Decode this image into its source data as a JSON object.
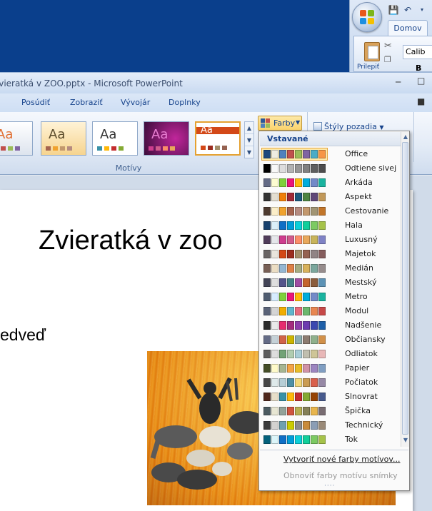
{
  "mini_window": {
    "home_tab": "Domov",
    "paste_label": "Prilepiť",
    "font_value": "Calib",
    "bold_label": "B"
  },
  "window": {
    "title": "Zvieratká v ZOO.pptx - Microsoft PowerPoint"
  },
  "tabs": [
    {
      "label": "Posúdiť"
    },
    {
      "label": "Zobraziť"
    },
    {
      "label": "Vývojár"
    },
    {
      "label": "Doplnky"
    }
  ],
  "ribbon": {
    "themes_group_label": "Motívy",
    "theme_aa": "Aa",
    "colors_button": "Farby",
    "background_styles_button": "Štýly pozadia"
  },
  "slide": {
    "title": "Zvieratká v zoo",
    "bullet": "edveď"
  },
  "colors_dropdown": {
    "section_header": "Vstavané",
    "selected": "Office",
    "schemes": [
      {
        "name": "Office",
        "colors": [
          "#1f497d",
          "#eeece1",
          "#4f81bd",
          "#c0504d",
          "#9bbb59",
          "#8064a2",
          "#4bacc6",
          "#f79646"
        ]
      },
      {
        "name": "Odtiene sivej",
        "colors": [
          "#000000",
          "#f8f8f8",
          "#dddddd",
          "#b2b2b2",
          "#969696",
          "#808080",
          "#5f5f5f",
          "#4d4d4d"
        ]
      },
      {
        "name": "Arkáda",
        "colors": [
          "#646b86",
          "#fdfcd0",
          "#7fd13b",
          "#ea157a",
          "#feb80a",
          "#00addc",
          "#738ac8",
          "#1ab39f"
        ]
      },
      {
        "name": "Aspekt",
        "colors": [
          "#323232",
          "#e3ded1",
          "#f07f09",
          "#9f2936",
          "#1b587c",
          "#4e8542",
          "#604878",
          "#c19859"
        ]
      },
      {
        "name": "Cestovanie",
        "colors": [
          "#4e3b30",
          "#fbeec9",
          "#f0a22e",
          "#a5644e",
          "#b58b80",
          "#c3986d",
          "#a19574",
          "#c17529"
        ]
      },
      {
        "name": "Hala",
        "colors": [
          "#17406d",
          "#dbeff9",
          "#0f6fc6",
          "#009dd9",
          "#0bd0d9",
          "#10cf9b",
          "#7cca62",
          "#a5c249"
        ]
      },
      {
        "name": "Luxusný",
        "colors": [
          "#503c5a",
          "#e5e6ea",
          "#ce3d8e",
          "#d15b8c",
          "#fc8e69",
          "#e8a85b",
          "#c8b45a",
          "#7f82c5"
        ]
      },
      {
        "name": "Majetok",
        "colors": [
          "#696464",
          "#e9e5dc",
          "#d34817",
          "#9b2d1f",
          "#a28e6a",
          "#956251",
          "#918485",
          "#855d5d"
        ]
      },
      {
        "name": "Medián",
        "colors": [
          "#775f55",
          "#ebddc3",
          "#94b6d2",
          "#dd8047",
          "#a5ab81",
          "#d8b25c",
          "#7ba79d",
          "#968c8c"
        ]
      },
      {
        "name": "Mestský",
        "colors": [
          "#424456",
          "#dedede",
          "#53548a",
          "#438086",
          "#a04da3",
          "#c4652d",
          "#8b5d3d",
          "#5c92b5"
        ]
      },
      {
        "name": "Metro",
        "colors": [
          "#4e5b6f",
          "#d6ecff",
          "#7fd13b",
          "#ea157a",
          "#feb80a",
          "#00addc",
          "#738ac8",
          "#1ab39f"
        ]
      },
      {
        "name": "Modul",
        "colors": [
          "#5a6378",
          "#d4d4d4",
          "#f0ad00",
          "#60b5cc",
          "#e66c7d",
          "#6bb76d",
          "#e88651",
          "#c64847"
        ]
      },
      {
        "name": "Nadšenie",
        "colors": [
          "#2c2c2c",
          "#e9e9e9",
          "#e62b6f",
          "#a42a7e",
          "#8e3dab",
          "#6d3ab0",
          "#3a49b0",
          "#1d5fa8"
        ]
      },
      {
        "name": "Občiansky",
        "colors": [
          "#646b86",
          "#c5d1d7",
          "#d16349",
          "#ccb400",
          "#8cadae",
          "#8c7b70",
          "#8fb08c",
          "#d19049"
        ]
      },
      {
        "name": "Odliatok",
        "colors": [
          "#5e5e5e",
          "#dddddd",
          "#72a376",
          "#b0ccb0",
          "#a8cdd7",
          "#c0beaf",
          "#cec597",
          "#e8b7b7"
        ]
      },
      {
        "name": "Papier",
        "colors": [
          "#444d26",
          "#fefac9",
          "#a5b592",
          "#f3a447",
          "#e7bc29",
          "#d092a7",
          "#9c85c0",
          "#809ec2"
        ]
      },
      {
        "name": "Počiatok",
        "colors": [
          "#464646",
          "#dee9ea",
          "#b6ced6",
          "#4e8fa4",
          "#f2d87b",
          "#ca9c53",
          "#d95f4c",
          "#9688a5"
        ]
      },
      {
        "name": "Slnovrat",
        "colors": [
          "#4f271c",
          "#e7dec9",
          "#3891a7",
          "#feb80a",
          "#c32d2e",
          "#84aa33",
          "#964305",
          "#475a8d"
        ]
      },
      {
        "name": "Špička",
        "colors": [
          "#4b5a60",
          "#e7e6d3",
          "#93a299",
          "#cf543f",
          "#b5ae53",
          "#848058",
          "#e8b54d",
          "#786c71"
        ]
      },
      {
        "name": "Technický",
        "colors": [
          "#3b3b3b",
          "#d4d2d0",
          "#6ea0b0",
          "#cccc00",
          "#8c8c8c",
          "#c98b3b",
          "#8b9db5",
          "#9a8a78"
        ]
      },
      {
        "name": "Tok",
        "colors": [
          "#04617b",
          "#dbf5f9",
          "#0f6fc6",
          "#009dd9",
          "#0bd0d9",
          "#10cf9b",
          "#7cca62",
          "#a5c249"
        ]
      }
    ],
    "create_new": "Vytvoriť nové farby motívov...",
    "reset": "Obnoviť farby motívu snímky",
    "grip": "····"
  }
}
